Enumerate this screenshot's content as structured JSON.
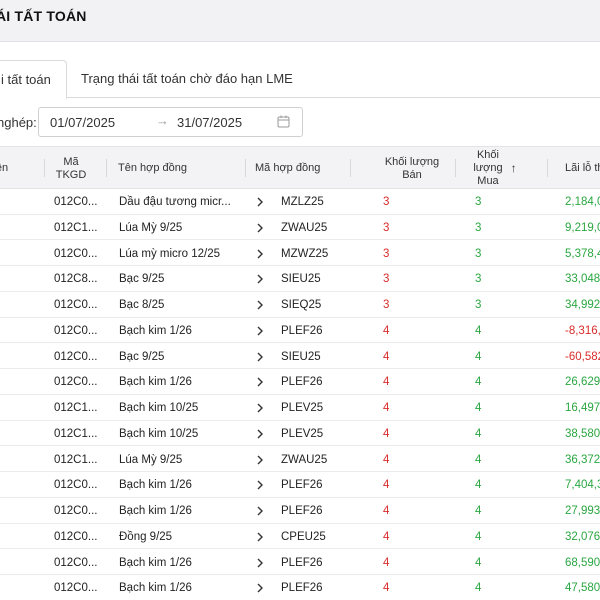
{
  "page": {
    "title": "ÁI TẤT TOÁN"
  },
  "tabs": [
    {
      "label": "i tất toán",
      "active": true
    },
    {
      "label": "Trạng thái tất toán chờ đáo hạn LME",
      "active": false
    }
  ],
  "filter": {
    "label": "nghép:",
    "from_date": "01/07/2025",
    "arrow": "→",
    "to_date": "31/07/2025",
    "calendar_icon": "calendar-icon"
  },
  "table": {
    "headers": {
      "col0": "ền",
      "tkgd": "Mã\nTKGD",
      "contract_name": "Tên hợp đồng",
      "contract_code": "Mã hợp đồng",
      "sell_qty": "Khối lượng\nBán",
      "buy_qty": "Khối\nlượng\nMua",
      "sort_icon": "↑",
      "pl": "Lãi lỗ th"
    },
    "rows": [
      {
        "tkgd": "012C0...",
        "name": "Dầu đậu tương micr...",
        "code": "MZLZ25",
        "sell": "3",
        "buy": "3",
        "pl": "2,184,0",
        "pl_sign": "pos"
      },
      {
        "tkgd": "012C1...",
        "name": "Lúa Mỳ 9/25",
        "code": "ZWAU25",
        "sell": "3",
        "buy": "3",
        "pl": "9,219,0",
        "pl_sign": "pos"
      },
      {
        "tkgd": "012C0...",
        "name": "Lúa mỳ micro 12/25",
        "code": "MZWZ25",
        "sell": "3",
        "buy": "3",
        "pl": "5,378,4",
        "pl_sign": "pos"
      },
      {
        "tkgd": "012C8...",
        "name": "Bạc 9/25",
        "code": "SIEU25",
        "sell": "3",
        "buy": "3",
        "pl": "33,048",
        "pl_sign": "pos"
      },
      {
        "tkgd": "012C0...",
        "name": "Bạc 8/25",
        "code": "SIEQ25",
        "sell": "3",
        "buy": "3",
        "pl": "34,992",
        "pl_sign": "pos"
      },
      {
        "tkgd": "012C0...",
        "name": "Bạch kim 1/26",
        "code": "PLEF26",
        "sell": "4",
        "buy": "4",
        "pl": "-8,316,",
        "pl_sign": "neg"
      },
      {
        "tkgd": "012C0...",
        "name": "Bạc 9/25",
        "code": "SIEU25",
        "sell": "4",
        "buy": "4",
        "pl": "-60,582",
        "pl_sign": "neg"
      },
      {
        "tkgd": "012C0...",
        "name": "Bạch kim 1/26",
        "code": "PLEF26",
        "sell": "4",
        "buy": "4",
        "pl": "26,629",
        "pl_sign": "pos"
      },
      {
        "tkgd": "012C1...",
        "name": "Bạch kim 10/25",
        "code": "PLEV25",
        "sell": "4",
        "buy": "4",
        "pl": "16,497",
        "pl_sign": "pos"
      },
      {
        "tkgd": "012C1...",
        "name": "Bạch kim 10/25",
        "code": "PLEV25",
        "sell": "4",
        "buy": "4",
        "pl": "38,580",
        "pl_sign": "pos"
      },
      {
        "tkgd": "012C1...",
        "name": "Lúa Mỳ 9/25",
        "code": "ZWAU25",
        "sell": "4",
        "buy": "4",
        "pl": "36,372",
        "pl_sign": "pos"
      },
      {
        "tkgd": "012C0...",
        "name": "Bạch kim 1/26",
        "code": "PLEF26",
        "sell": "4",
        "buy": "4",
        "pl": "7,404,3",
        "pl_sign": "pos"
      },
      {
        "tkgd": "012C0...",
        "name": "Bạch kim 1/26",
        "code": "PLEF26",
        "sell": "4",
        "buy": "4",
        "pl": "27,993",
        "pl_sign": "pos"
      },
      {
        "tkgd": "012C0...",
        "name": "Đồng 9/25",
        "code": "CPEU25",
        "sell": "4",
        "buy": "4",
        "pl": "32,076",
        "pl_sign": "pos"
      },
      {
        "tkgd": "012C0...",
        "name": "Bạch kim 1/26",
        "code": "PLEF26",
        "sell": "4",
        "buy": "4",
        "pl": "68,590",
        "pl_sign": "pos"
      },
      {
        "tkgd": "012C0...",
        "name": "Bạch kim 1/26",
        "code": "PLEF26",
        "sell": "4",
        "buy": "4",
        "pl": "47,580",
        "pl_sign": "pos"
      }
    ]
  },
  "colors": {
    "positive": "#2aa641",
    "negative": "#d92b2b",
    "header_bg": "#f3f3f5"
  },
  "icons": {
    "row_expand": "chevron-right-icon",
    "sort": "arrow-up-icon",
    "date": "calendar-icon"
  }
}
